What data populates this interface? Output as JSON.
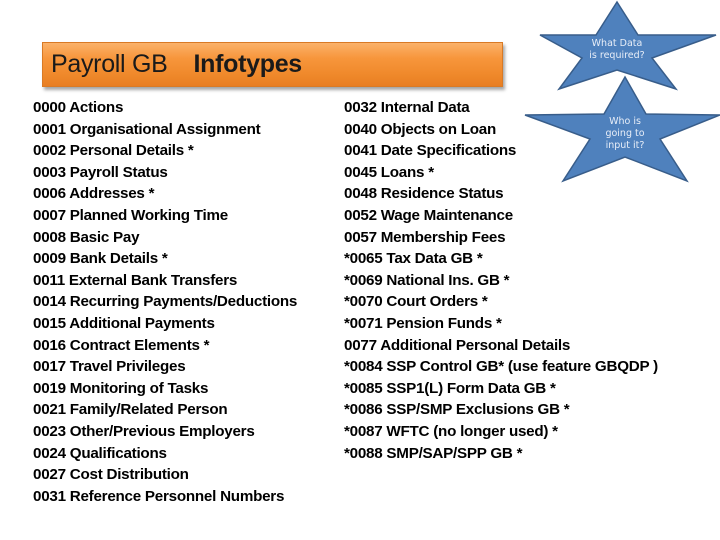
{
  "header": {
    "title_plain": "Payroll GB",
    "title_bold": "Infotypes"
  },
  "callouts": [
    {
      "text_lines": [
        "What Data",
        "is required?"
      ],
      "shape": "star",
      "fill": "#4f81bd",
      "stroke": "#385d8a"
    },
    {
      "text_lines": [
        "Who is",
        "going to",
        "input it?"
      ],
      "shape": "star",
      "fill": "#4f81bd",
      "stroke": "#385d8a"
    }
  ],
  "infotypes_left": [
    "0000 Actions",
    "0001 Organisational Assignment",
    "0002 Personal Details *",
    "0003 Payroll Status",
    "0006 Addresses *",
    "0007 Planned Working Time",
    "0008 Basic Pay",
    "0009 Bank Details *",
    "0011 External Bank Transfers",
    "0014 Recurring Payments/Deductions",
    "0015 Additional Payments",
    "0016 Contract Elements *",
    "0017 Travel Privileges",
    "0019 Monitoring of Tasks",
    "0021 Family/Related Person",
    "0023 Other/Previous Employers",
    "0024 Qualifications",
    "0027 Cost Distribution",
    "0031 Reference Personnel Numbers"
  ],
  "infotypes_right": [
    "0032 Internal Data",
    "0040 Objects on Loan",
    "0041 Date Specifications",
    "0045 Loans *",
    "0048 Residence Status",
    "0052 Wage Maintenance",
    "0057 Membership Fees",
    "*0065 Tax Data GB *",
    "*0069 National Ins. GB *",
    "*0070 Court Orders *",
    "*0071 Pension Funds *",
    "0077 Additional Personal Details",
    "*0084 SSP Control GB* (use feature GBQDP )",
    "*0085 SSP1(L) Form Data GB *",
    "*0086 SSP/SMP Exclusions GB *",
    "*0087 WFTC (no longer used) *",
    "*0088 SMP/SAP/SPP GB *"
  ],
  "colors": {
    "banner_orange": "#f7963c",
    "star_blue": "#4f81bd",
    "star_border": "#385d8a"
  }
}
